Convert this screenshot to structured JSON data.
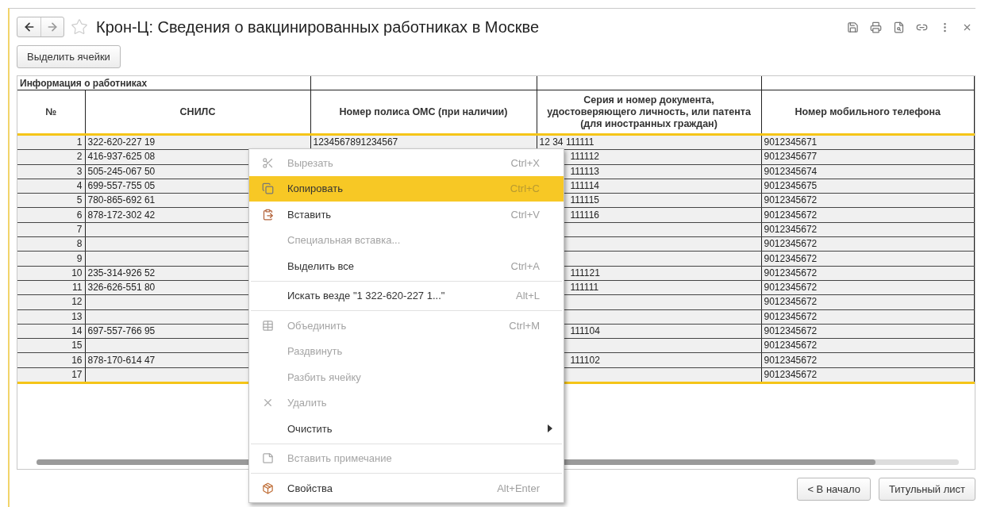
{
  "window": {
    "title": "Крон-Ц: Сведения о вакцинированных работниках в Москве",
    "favorite": false
  },
  "toolbar": {
    "select_button": "Выделить ячейки"
  },
  "table": {
    "group_header": "Информация о работниках",
    "columns": [
      "№",
      "СНИЛС",
      "Номер полиса ОМС (при наличии)",
      "Серия и номер документа, удостоверяющего личность, или патента (для иностранных граждан)",
      "Номер мобильного телефона"
    ],
    "rows": [
      {
        "n": "1",
        "snils": "322-620-227 19",
        "oms": "1234567891234567",
        "doc": "12 34 111111",
        "phone": "9012345671",
        "menu_over": false
      },
      {
        "n": "2",
        "snils": "416-937-625 08",
        "doc": "111112",
        "phone": "9012345677",
        "menu_over": true
      },
      {
        "n": "3",
        "snils": "505-245-067 50",
        "doc": "111113",
        "phone": "9012345674",
        "menu_over": true
      },
      {
        "n": "4",
        "snils": "699-557-755 05",
        "doc": "111114",
        "phone": "9012345675",
        "menu_over": true
      },
      {
        "n": "5",
        "snils": "780-865-692 61",
        "doc": "111115",
        "phone": "9012345672",
        "menu_over": true
      },
      {
        "n": "6",
        "snils": "878-172-302 42",
        "doc": "111116",
        "phone": "9012345672",
        "menu_over": true
      },
      {
        "n": "7",
        "phone": "9012345672"
      },
      {
        "n": "8",
        "phone": "9012345672"
      },
      {
        "n": "9",
        "phone": "9012345672"
      },
      {
        "n": "10",
        "snils": "235-314-926 52",
        "doc": "111121",
        "phone": "9012345672",
        "menu_over": true
      },
      {
        "n": "11",
        "snils": "326-626-551 80",
        "doc": "111111",
        "phone": "9012345672",
        "menu_over": true
      },
      {
        "n": "12",
        "phone": "9012345672"
      },
      {
        "n": "13",
        "phone": "9012345672"
      },
      {
        "n": "14",
        "snils": "697-557-766 95",
        "doc": "111104",
        "phone": "9012345672",
        "menu_over": true
      },
      {
        "n": "15",
        "phone": "9012345672"
      },
      {
        "n": "16",
        "snils": "878-170-614 47",
        "doc": "111102",
        "phone": "9012345672",
        "menu_over": true
      },
      {
        "n": "17",
        "phone": "9012345672"
      }
    ]
  },
  "context_menu": {
    "items": [
      {
        "kind": "item",
        "label": "Вырезать",
        "shortcut": "Ctrl+X",
        "disabled": true,
        "selected": false
      },
      {
        "kind": "item",
        "label": "Копировать",
        "shortcut": "Ctrl+C",
        "disabled": false,
        "selected": true
      },
      {
        "kind": "item",
        "label": "Вставить",
        "shortcut": "Ctrl+V",
        "disabled": false,
        "selected": false
      },
      {
        "kind": "item",
        "label": "Специальная вставка...",
        "disabled": true,
        "selected": false
      },
      {
        "kind": "item",
        "label": "Выделить все",
        "shortcut": "Ctrl+A",
        "disabled": false,
        "selected": false
      },
      {
        "kind": "separator"
      },
      {
        "kind": "item",
        "label": "Искать везде \"1 322-620-227 1...\"",
        "shortcut": "Alt+L",
        "disabled": false,
        "selected": false
      },
      {
        "kind": "separator"
      },
      {
        "kind": "item",
        "label": "Объединить",
        "shortcut": "Ctrl+M",
        "disabled": true,
        "selected": false
      },
      {
        "kind": "item",
        "label": "Раздвинуть",
        "disabled": true,
        "selected": false
      },
      {
        "kind": "item",
        "label": "Разбить ячейку",
        "disabled": true,
        "selected": false
      },
      {
        "kind": "item",
        "label": "Удалить",
        "disabled": true,
        "selected": false
      },
      {
        "kind": "item",
        "label": "Очистить",
        "disabled": false,
        "selected": false,
        "submenu": true
      },
      {
        "kind": "separator"
      },
      {
        "kind": "item",
        "label": "Вставить примечание",
        "disabled": true,
        "selected": false
      },
      {
        "kind": "separator"
      },
      {
        "kind": "item",
        "label": "Свойства",
        "shortcut": "Alt+Enter",
        "disabled": false,
        "selected": false
      }
    ]
  },
  "footer": {
    "buttons": [
      "< В начало",
      "Титульный лист"
    ]
  }
}
